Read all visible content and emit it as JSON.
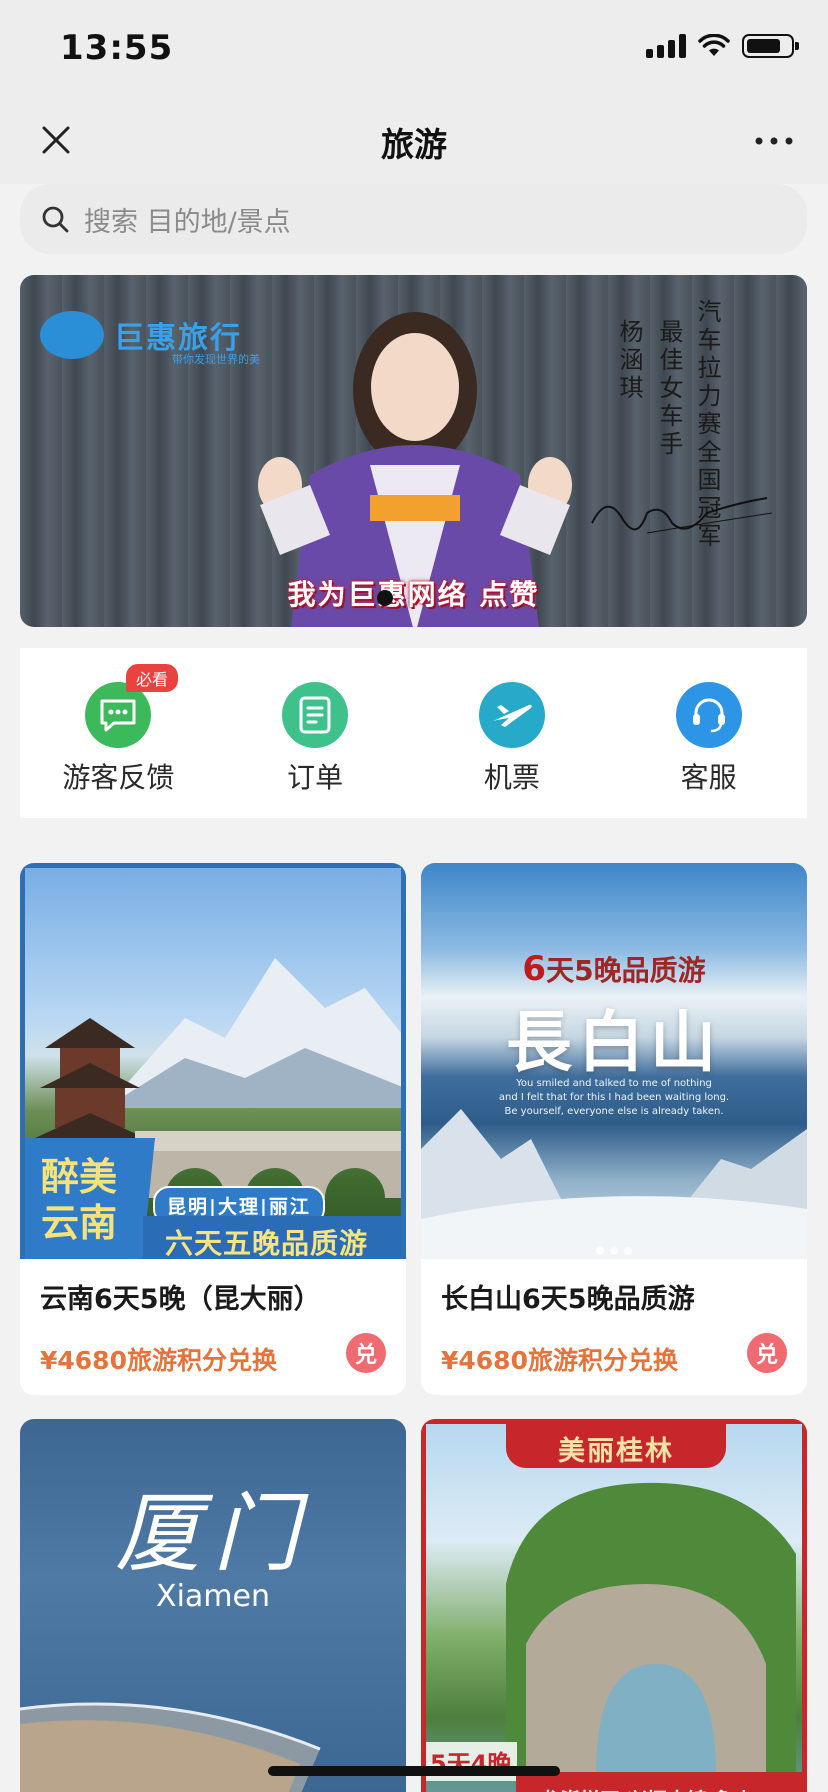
{
  "status_bar": {
    "time": "13:55"
  },
  "nav": {
    "title": "旅游"
  },
  "search": {
    "placeholder": "搜索 目的地/景点"
  },
  "banner": {
    "brand": "巨惠旅行",
    "brand_tagline": "带你发现世界的美",
    "vertical_text": [
      "汽车拉力赛全国冠军",
      "最佳女车手",
      "杨涵琪"
    ],
    "caption": "我为巨惠网络 点赞"
  },
  "quick_menu": {
    "items": [
      {
        "label": "游客反馈",
        "badge": "必看",
        "icon": "feedback-icon",
        "color": "#3cb95a"
      },
      {
        "label": "订单",
        "icon": "order-icon",
        "color": "#3fc18c"
      },
      {
        "label": "机票",
        "icon": "plane-icon",
        "color": "#27a9c9"
      },
      {
        "label": "客服",
        "icon": "headset-icon",
        "color": "#2d95e6"
      }
    ]
  },
  "products": [
    {
      "title": "云南6天5晚（昆大丽）",
      "price": "¥4680旅游积分兑换",
      "redeem": "兑",
      "image": {
        "brand": [
          "醉美",
          "云南"
        ],
        "route": "昆明|大理|丽江",
        "tour": "六天五晚品质游"
      }
    },
    {
      "title": "长白山6天5晚品质游",
      "price": "¥4680旅游积分兑换",
      "redeem": "兑",
      "image": {
        "sub_num": "6",
        "sub_rest": "天5晚品质游",
        "big": "長白山",
        "english": [
          "You smiled and talked to me of nothing",
          "and I felt that for this I had been waiting long.",
          "Be yourself, everyone else is already taken."
        ]
      }
    },
    {
      "image": {
        "cn": "厦门",
        "en": "Xiamen"
      }
    },
    {
      "image": {
        "ribbon": "美丽桂林",
        "days": "5天4晚",
        "strip": "龙脊梯田  兴坪古镇  象山"
      }
    }
  ]
}
